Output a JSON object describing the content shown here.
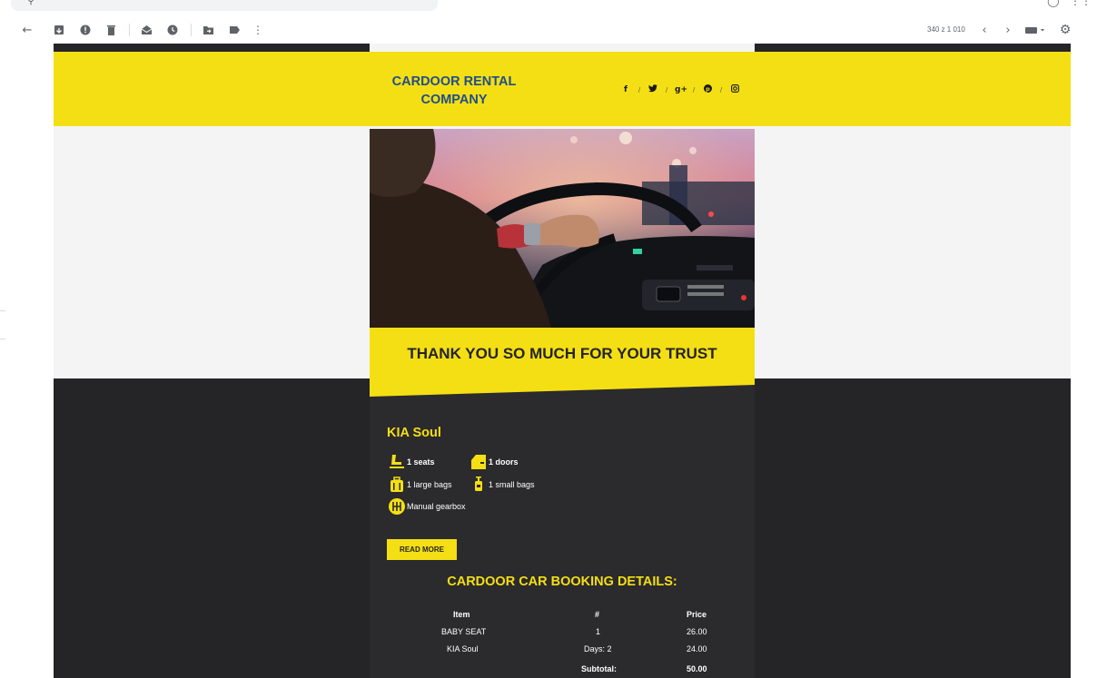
{
  "gmail": {
    "toolbar": {
      "back_icon": "arrow-left-icon",
      "archive_icon": "archive-icon",
      "spam_icon": "report-spam-icon",
      "delete_icon": "trash-icon",
      "mark_unread_icon": "mail-open-icon",
      "snooze_icon": "clock-icon",
      "move_icon": "folder-move-icon",
      "label_icon": "label-icon",
      "more_icon": "vertical-dots-icon",
      "page_count": "340 z 1 010",
      "prev_icon": "chevron-left-icon",
      "next_icon": "chevron-right-icon",
      "input_tools_icon": "keyboard-icon",
      "settings_icon": "gear-icon"
    }
  },
  "email": {
    "brand": "CARDOOR RENTAL COMPANY",
    "social": [
      "f",
      "t",
      "g+",
      "p",
      "ig"
    ],
    "headline": "THANK YOU SO MUCH FOR YOUR TRUST",
    "car": {
      "name": "KIA Soul",
      "seats": "1 seats",
      "doors": "1 doors",
      "large_bags": "1 large bags",
      "small_bags": "1 small bags",
      "gearbox": "Manual gearbox"
    },
    "read_more": "READ MORE",
    "booking": {
      "title": "CARDOOR CAR BOOKING DETAILS:",
      "columns": [
        "Item",
        "#",
        "Price"
      ],
      "rows": [
        {
          "item": "BABY SEAT",
          "qty": "1",
          "price": "26.00"
        },
        {
          "item": "KIA Soul",
          "qty": "Days: 2",
          "price": "24.00"
        }
      ],
      "subtotal_label": "Subtotal:",
      "subtotal_value": "50.00"
    },
    "colors": {
      "accent": "#f4df14",
      "dark": "#252427",
      "brand_text": "#1f4e8c"
    }
  }
}
